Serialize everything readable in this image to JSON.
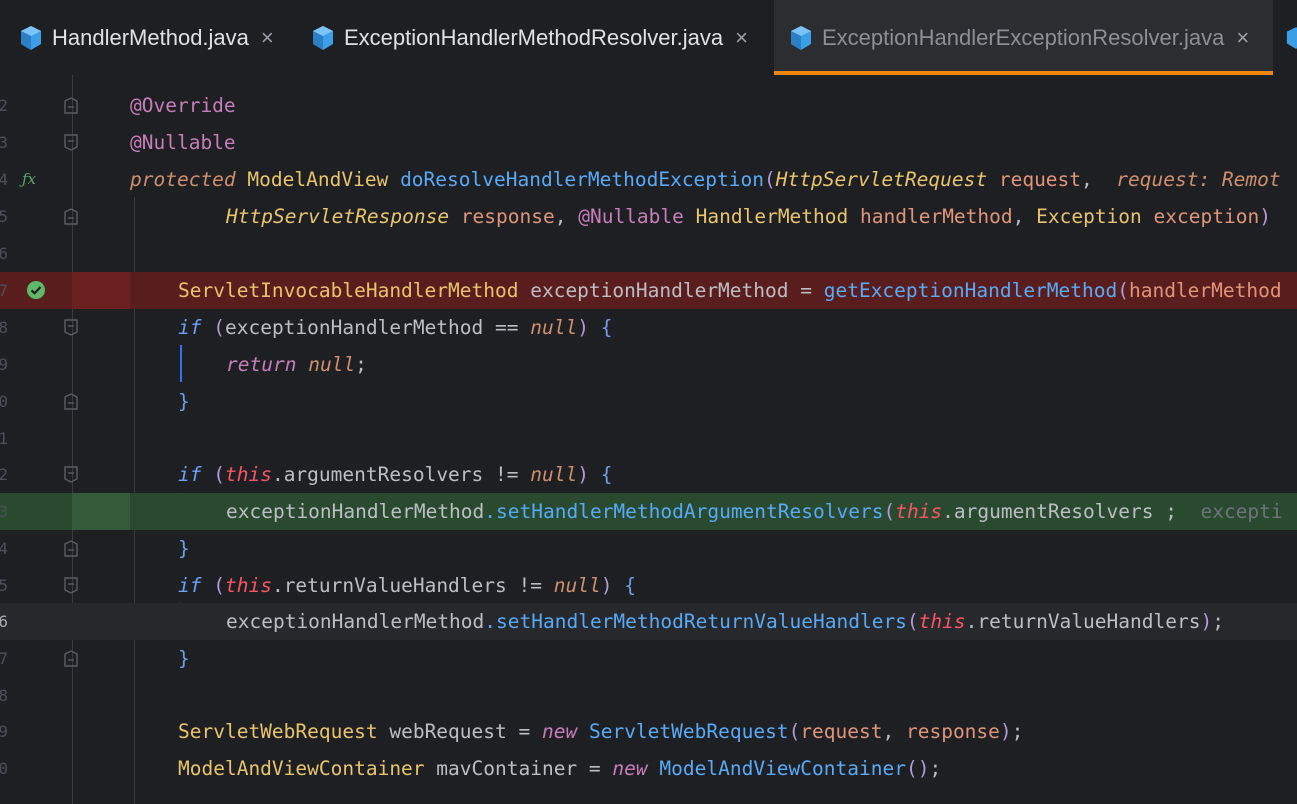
{
  "tabs": [
    {
      "label": "HandlerMethod.java",
      "active": false
    },
    {
      "label": "ExceptionHandlerMethodResolver.java",
      "active": false
    },
    {
      "label": "ExceptionHandlerExceptionResolver.java",
      "active": true
    }
  ],
  "close_glyph": "×",
  "gutter": {
    "line_numbers": [
      "2",
      "3",
      "4",
      "5",
      "6",
      "7",
      "8",
      "9",
      "0",
      "1",
      "2",
      "3",
      "4",
      "5",
      "6",
      "7",
      "8",
      "9",
      "0"
    ],
    "icons": {
      "method_icon": "fx-override-icon",
      "breakpoint_ok": "check-circle-icon"
    }
  },
  "code": {
    "l1_a": "@Override",
    "l2_a": "@Nullable",
    "l3_kw": "protected",
    "l3_type": "ModelAndView",
    "l3_fn": "doResolveHandlerMethodException",
    "l3_ptype": "HttpServletRequest",
    "l3_param": "request",
    "l3_hint": "request: Remot",
    "l4_t1": "HttpServletResponse",
    "l4_p1": "response",
    "l4_ann": "@Nullable",
    "l4_t2": "HandlerMethod",
    "l4_p2": "handlerMethod",
    "l4_t3": "Exception",
    "l4_p3": "exception",
    "l6_type": "ServletInvocableHandlerMethod",
    "l6_var": "exceptionHandlerMethod",
    "l6_fn": "getExceptionHandlerMethod",
    "l6_arg": "handlerMethod",
    "l7_if": "if",
    "l7_var": "exceptionHandlerMethod",
    "l7_null": "null",
    "l8_ret": "return",
    "l8_null": "null",
    "l11_if": "if",
    "l11_this": "this",
    "l11_field": ".argumentResolvers",
    "l11_null": "null",
    "l12_var": "exceptionHandlerMethod",
    "l12_fn": ".setHandlerMethodArgumentResolvers",
    "l12_this": "this",
    "l12_field": ".argumentResolvers",
    "l12_hint": "excepti",
    "l14_if": "if",
    "l14_this": "this",
    "l14_field": ".returnValueHandlers",
    "l14_null": "null",
    "l15_var": "exceptionHandlerMethod",
    "l15_fn": ".setHandlerMethodReturnValueHandlers",
    "l15_this": "this",
    "l15_field": ".returnValueHandlers",
    "l18_type": "ServletWebRequest",
    "l18_var": "webRequest",
    "l18_new": "new",
    "l18_ctor": "ServletWebRequest",
    "l18_a1": "request",
    "l18_a2": "response",
    "l19_type": "ModelAndViewContainer",
    "l19_var": "mavContainer",
    "l19_new": "new",
    "l19_ctor": "ModelAndViewContainer"
  },
  "colors": {
    "background": "#1e1f22",
    "active_tab_underline": "#f0870a",
    "error_line_bg": "#5a1d1d",
    "ok_line_bg": "#2a4a30",
    "keyword": "#cf8e6d",
    "type": "#e8c46a",
    "method": "#57aaf7",
    "annotation": "#c77dbb"
  }
}
